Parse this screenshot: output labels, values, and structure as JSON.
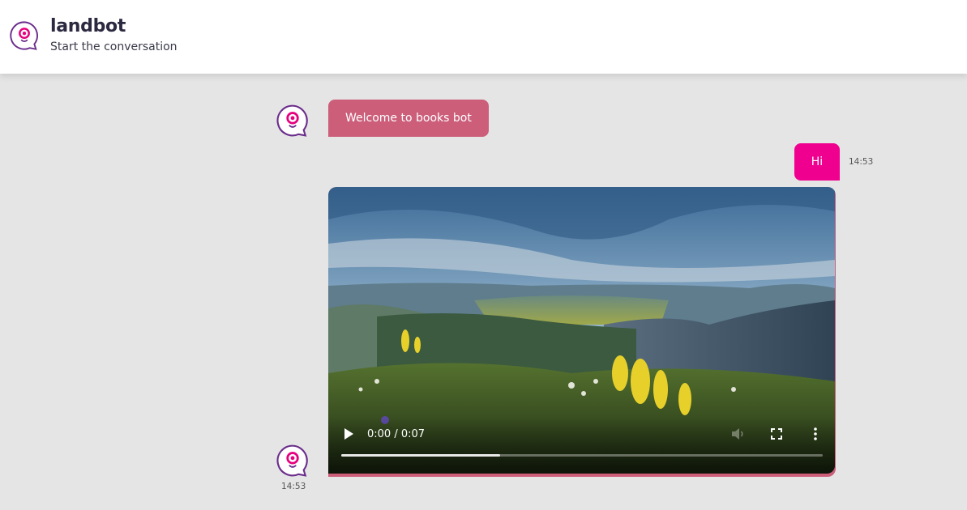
{
  "header": {
    "title": "landbot",
    "subtitle": "Start the conversation",
    "logo_icon": "landbot-chat-icon"
  },
  "messages": [
    {
      "from": "bot",
      "type": "text",
      "text": "Welcome to books bot"
    },
    {
      "from": "user",
      "type": "text",
      "text": "Hi",
      "time": "14:53"
    },
    {
      "from": "bot",
      "type": "video",
      "time": "14:53",
      "video": {
        "time_display": "0:00 / 0:07",
        "progress": 0.33,
        "play_icon": "play-icon",
        "volume_icon": "volume-icon",
        "fullscreen_icon": "fullscreen-icon",
        "more_icon": "more-vert-icon"
      }
    }
  ],
  "colors": {
    "bot_bubble": "#cc5e7a",
    "user_bubble": "#f0008f",
    "background": "#e5e5e5",
    "brand_pink": "#e6007e",
    "brand_purple": "#6b2d8c",
    "title_color": "#2b2940"
  }
}
